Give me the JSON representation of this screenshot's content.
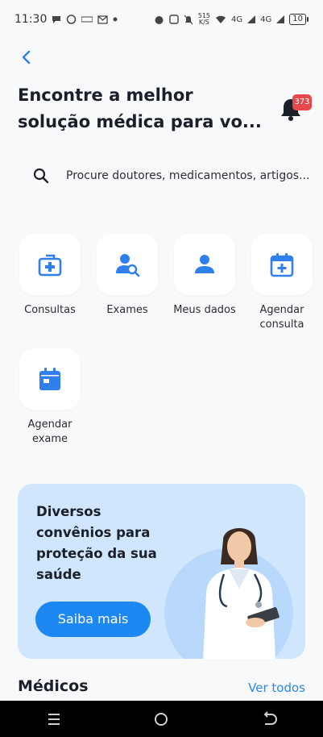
{
  "status_bar": {
    "time": "11:30",
    "speed_value": "515",
    "speed_unit": "K/S",
    "network_1": "4G",
    "network_2": "4G",
    "battery": "10"
  },
  "header": {
    "headline": "Encontre a melhor solução médica para vo...",
    "notification_count": "373"
  },
  "search": {
    "placeholder": "Procure doutores, medicamentos, artigos..."
  },
  "shortcuts": [
    {
      "label": "Consultas",
      "icon": "medical-kit-icon"
    },
    {
      "label": "Exames",
      "icon": "user-search-icon"
    },
    {
      "label": "Meus dados",
      "icon": "person-icon"
    },
    {
      "label": "Agendar consulta",
      "icon": "calendar-add-icon"
    },
    {
      "label": "Agendar exame",
      "icon": "calendar-icon"
    }
  ],
  "banner": {
    "text": "Diversos convênios para proteção da sua saúde",
    "button": "Saiba mais"
  },
  "doctors_section": {
    "title": "Médicos",
    "link": "Ver todos"
  },
  "colors": {
    "accent": "#1e88f2",
    "icon_blue": "#2f80ed",
    "banner_bg": "#cfe6fc",
    "badge": "#e5484d"
  }
}
